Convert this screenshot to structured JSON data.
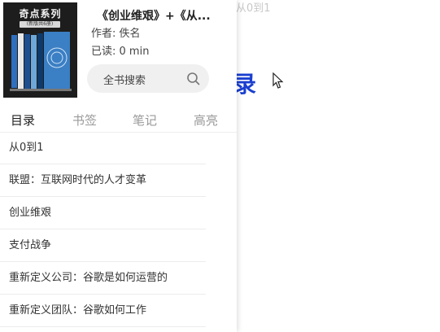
{
  "reader": {
    "heading": "目录",
    "chapter_label": "从0到1"
  },
  "panel": {
    "cover": {
      "title": "奇点系列",
      "subtitle": "(新版共6册)"
    },
    "book": {
      "title": "《创业维艰》+《从...",
      "author": "作者: 佚名",
      "read_time": "已读: 0  min"
    },
    "search": {
      "label": "全书搜索"
    },
    "tabs": [
      "目录",
      "书签",
      "笔记",
      "高亮"
    ],
    "toc": [
      "从0到1",
      "联盟：互联网时代的人才变革",
      "创业维艰",
      "支付战争",
      "重新定义公司：谷歌是如何运营的",
      "重新定义团队：谷歌如何工作"
    ]
  },
  "colors": {
    "accent_blue": "#1a3fd0",
    "active_tab": "#222222",
    "inactive_tab": "#9a9a9a"
  },
  "icons": [
    "lock-icon",
    "search-icon",
    "cursor-icon"
  ]
}
